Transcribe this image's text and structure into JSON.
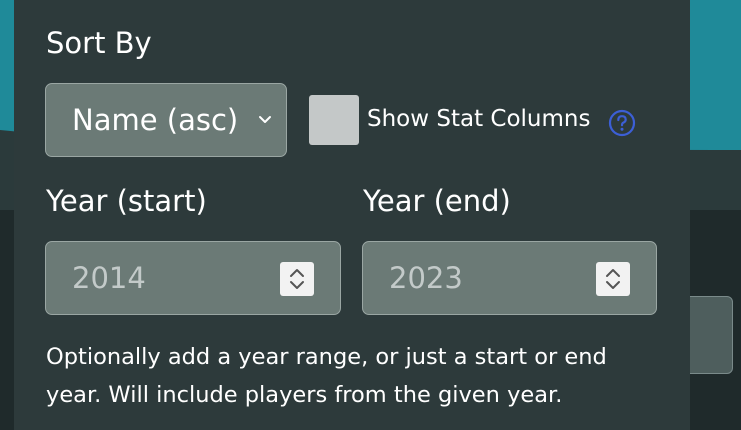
{
  "sort": {
    "label": "Sort By",
    "selected": "Name (asc)"
  },
  "stat_columns": {
    "label": "Show Stat Columns",
    "checked": false
  },
  "year_start": {
    "label": "Year (start)",
    "value": "2014"
  },
  "year_end": {
    "label": "Year (end)",
    "value": "2023"
  },
  "help_text": "Optionally add a year range, or just a start or end year. Will include players from the given year.",
  "colors": {
    "panel": "#2d3a3b",
    "input": "#6b7a76",
    "accent_teal": "#1f8a99",
    "help_icon": "#3c5fd6"
  },
  "icons": [
    "chevron-down-icon",
    "question-circle-icon",
    "stepper-icon"
  ]
}
